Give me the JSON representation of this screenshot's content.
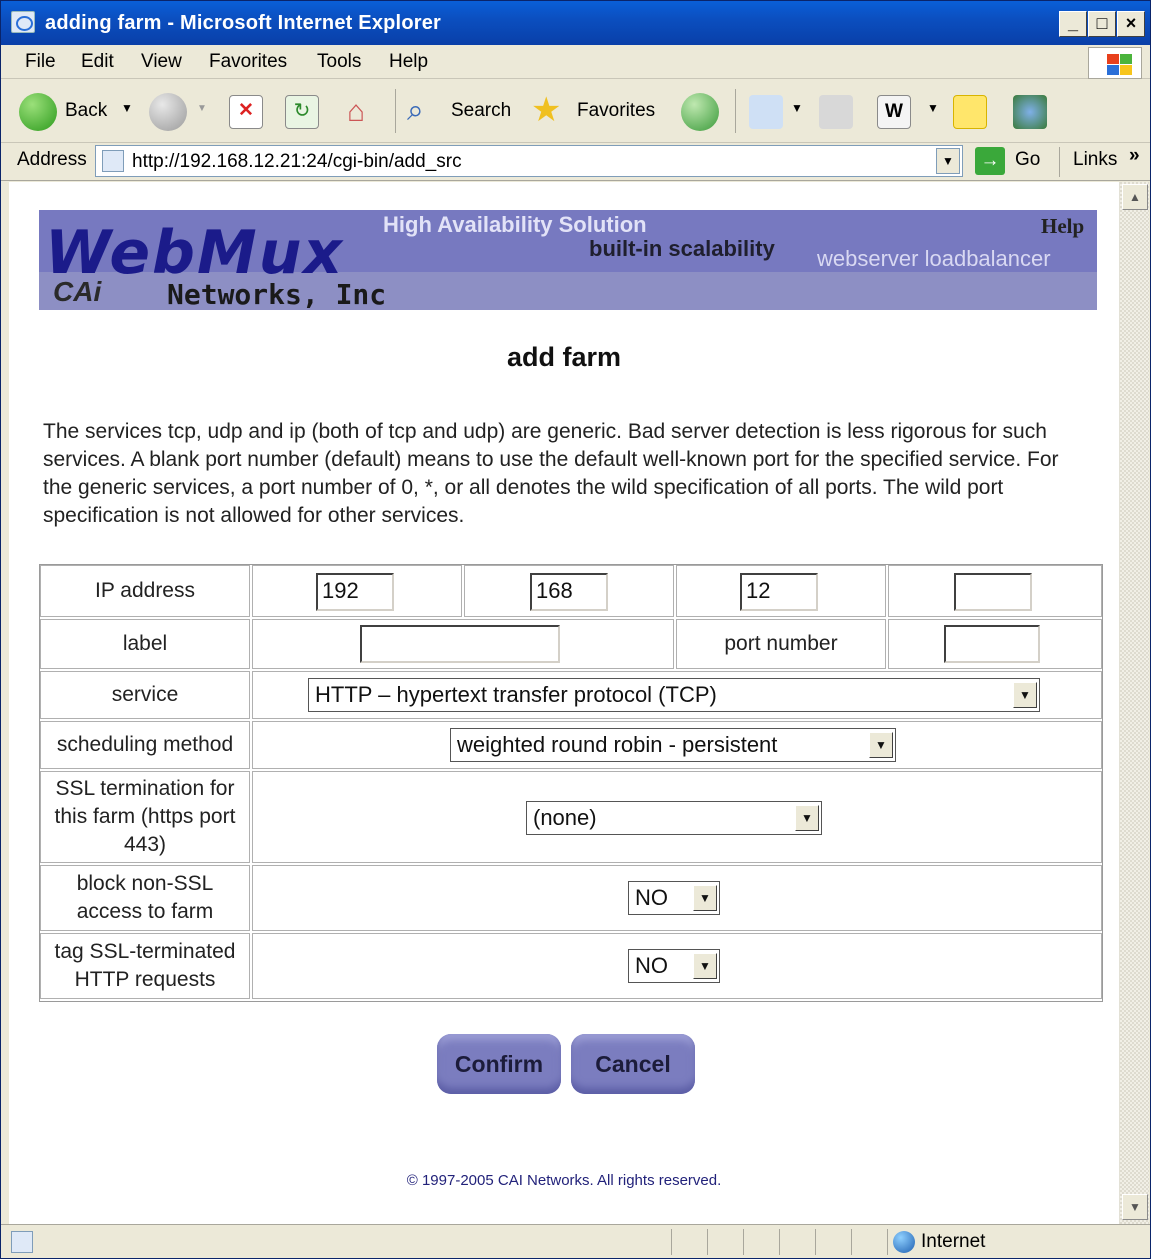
{
  "window": {
    "title": "adding farm - Microsoft Internet Explorer"
  },
  "menu": {
    "items": [
      "File",
      "Edit",
      "View",
      "Favorites",
      "Tools",
      "Help"
    ]
  },
  "toolbar": {
    "back": "Back",
    "search": "Search",
    "favorites": "Favorites"
  },
  "address": {
    "label": "Address",
    "url": "http://192.168.12.21:24/cgi-bin/add_src",
    "go": "Go",
    "links": "Links"
  },
  "banner": {
    "logo": "WebMux",
    "tagline1": "High Availability Solution",
    "tagline2": "built-in scalability",
    "tagline3": "webserver loadbalancer",
    "help": "Help",
    "company_mark": "CAi",
    "company_name": "Networks, Inc"
  },
  "page": {
    "title": "add farm",
    "intro": "The services tcp, udp and ip (both of tcp and udp) are generic. Bad server detection is less rigorous for such services. A blank port number (default) means to use the default well-known port for the specified service. For the generic services, a port number of 0, *, or all denotes the wild specification of all ports. The wild port specification is not allowed for other services."
  },
  "form": {
    "ip_label": "IP address",
    "ip": [
      "192",
      "168",
      "12",
      ""
    ],
    "label_label": "label",
    "label_value": "",
    "port_label": "port number",
    "port_value": "",
    "service_label": "service",
    "service_value": "HTTP – hypertext transfer protocol (TCP)",
    "scheduling_label": "scheduling method",
    "scheduling_value": "weighted round robin - persistent",
    "ssl_label": "SSL termination for this farm (https port 443)",
    "ssl_value": "(none)",
    "block_label": "block non-SSL access to farm",
    "block_value": "NO",
    "tag_label": "tag SSL-terminated HTTP requests",
    "tag_value": "NO"
  },
  "buttons": {
    "confirm": "Confirm",
    "cancel": "Cancel"
  },
  "footer": {
    "copyright": "© 1997-2005 CAI Networks. All rights reserved."
  },
  "status": {
    "zone": "Internet"
  }
}
